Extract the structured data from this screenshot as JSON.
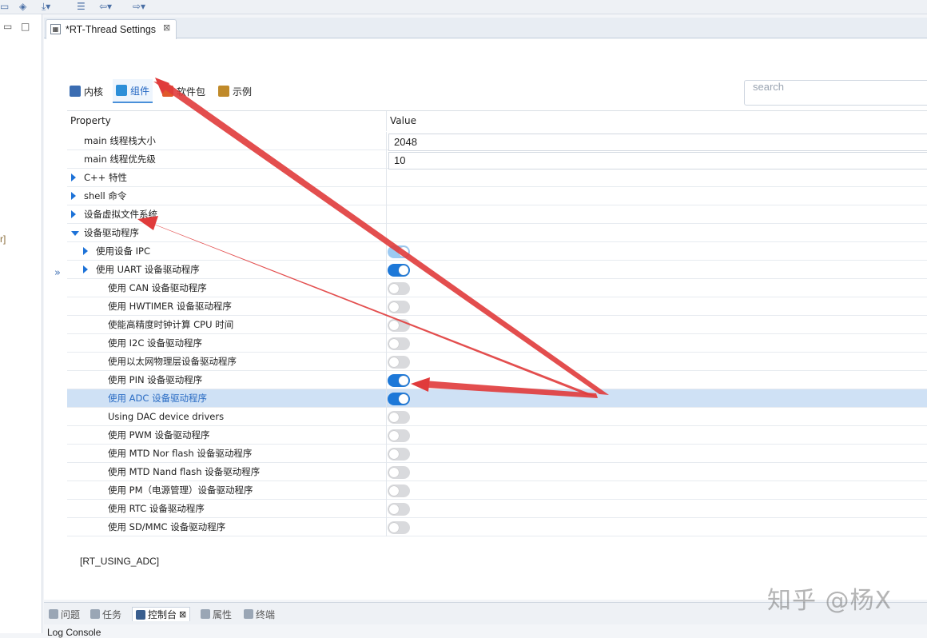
{
  "editor_tab": {
    "title": "*RT-Thread Settings",
    "close": "⊠"
  },
  "left_panel": {
    "fragment": "r]"
  },
  "sub_tabs": [
    {
      "label": "内核",
      "icon": "table-icon"
    },
    {
      "label": "组件",
      "icon": "cube-icon",
      "active": true
    },
    {
      "label": "软件包",
      "icon": "packages-icon"
    },
    {
      "label": "示例",
      "icon": "clipboard-icon"
    }
  ],
  "search": {
    "placeholder": "search"
  },
  "grid": {
    "headers": {
      "property": "Property",
      "value": "Value"
    },
    "rows": [
      {
        "label": "main 线程栈大小",
        "indent": 2,
        "value": "2048",
        "kind": "text"
      },
      {
        "label": "main 线程优先级",
        "indent": 2,
        "value": "10",
        "kind": "text"
      },
      {
        "label": "C++ 特性",
        "indent": 1,
        "expander": "right",
        "kind": "none"
      },
      {
        "label": "shell 命令",
        "indent": 1,
        "expander": "right",
        "kind": "none"
      },
      {
        "label": "设备虚拟文件系统",
        "indent": 1,
        "expander": "right",
        "kind": "none"
      },
      {
        "label": "设备驱动程序",
        "indent": 1,
        "expander": "down",
        "kind": "none"
      },
      {
        "label": "使用设备 IPC",
        "indent": 2,
        "expander": "right",
        "kind": "toggle",
        "on": true,
        "light": true
      },
      {
        "label": "使用 UART 设备驱动程序",
        "indent": 2,
        "expander": "right",
        "kind": "toggle",
        "on": true
      },
      {
        "label": "使用 CAN 设备驱动程序",
        "indent": 3,
        "kind": "toggle",
        "on": false
      },
      {
        "label": "使用 HWTIMER 设备驱动程序",
        "indent": 3,
        "kind": "toggle",
        "on": false
      },
      {
        "label": "使能高精度时钟计算 CPU 时间",
        "indent": 3,
        "kind": "toggle",
        "on": false
      },
      {
        "label": "使用 I2C 设备驱动程序",
        "indent": 3,
        "kind": "toggle",
        "on": false
      },
      {
        "label": "使用以太网物理层设备驱动程序",
        "indent": 3,
        "kind": "toggle",
        "on": false
      },
      {
        "label": "使用 PIN 设备驱动程序",
        "indent": 3,
        "kind": "toggle",
        "on": true
      },
      {
        "label": "使用 ADC 设备驱动程序",
        "indent": 3,
        "kind": "toggle",
        "on": true,
        "selected": true
      },
      {
        "label": "Using DAC device drivers",
        "indent": 3,
        "kind": "toggle",
        "on": false
      },
      {
        "label": "使用 PWM 设备驱动程序",
        "indent": 3,
        "kind": "toggle",
        "on": false
      },
      {
        "label": "使用 MTD Nor flash 设备驱动程序",
        "indent": 3,
        "kind": "toggle",
        "on": false
      },
      {
        "label": "使用 MTD Nand flash 设备驱动程序",
        "indent": 3,
        "kind": "toggle",
        "on": false
      },
      {
        "label": "使用 PM（电源管理）设备驱动程序",
        "indent": 3,
        "kind": "toggle",
        "on": false
      },
      {
        "label": "使用 RTC 设备驱动程序",
        "indent": 3,
        "kind": "toggle",
        "on": false
      },
      {
        "label": "使用 SD/MMC 设备驱动程序",
        "indent": 3,
        "kind": "toggle",
        "on": false
      }
    ]
  },
  "macro_name": "[RT_USING_ADC]",
  "bottom_tabs": [
    {
      "label": "问题",
      "icon": "problems-icon"
    },
    {
      "label": "任务",
      "icon": "tasks-icon"
    },
    {
      "label": "控制台",
      "icon": "console-icon",
      "active": true,
      "close": "⊠"
    },
    {
      "label": "属性",
      "icon": "properties-icon"
    },
    {
      "label": "终端",
      "icon": "terminal-icon"
    }
  ],
  "console_title": "Log Console",
  "watermark": "知乎 @杨X",
  "colors": {
    "accent": "#1d78d8",
    "annotation": "#e03b3b",
    "selection": "#cfe1f5"
  }
}
